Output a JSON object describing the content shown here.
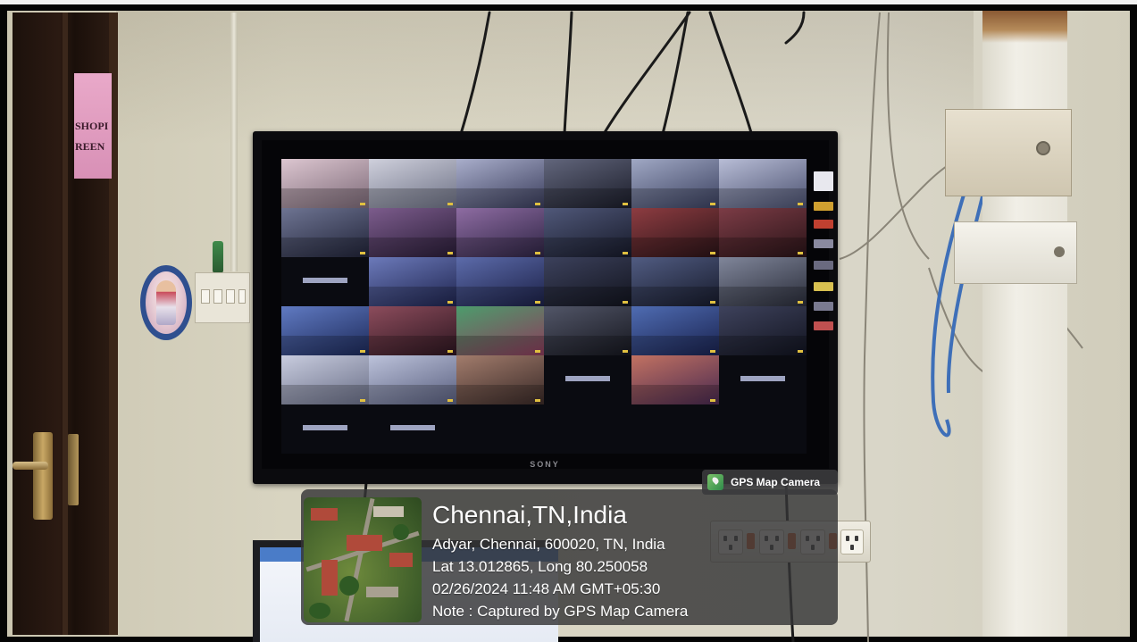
{
  "overlay": {
    "badge_label": "GPS Map Camera",
    "badge_icon": "map-pin-icon",
    "city": "Chennai,TN,India",
    "address": "Adyar, Chennai, 600020, TN, India",
    "coordinates": "Lat 13.012865, Long 80.250058",
    "datetime": "02/26/2024 11:48 AM GMT+05:30",
    "note": "Note : Captured by GPS Map Camera"
  },
  "tv": {
    "brand": "SONY"
  },
  "door_sign": {
    "line1": "SHOPI",
    "line2": "REEN"
  },
  "colors": {
    "wall": "#d8d4c2",
    "tv_bezel": "#0b0b0e",
    "overlay_bg": "#343436",
    "overlay_text": "#ffffff",
    "badge_icon": "#4faa5a",
    "door_sign": "#e9a9c9"
  }
}
